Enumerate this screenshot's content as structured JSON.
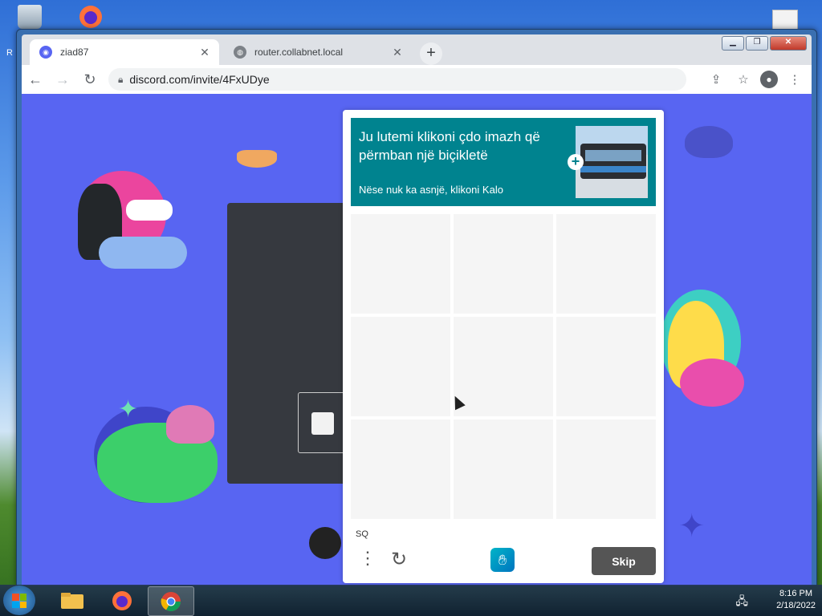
{
  "desktop": {
    "label_r": "R"
  },
  "browser": {
    "tabs": [
      {
        "title": "ziad87",
        "favicon": "discord-icon",
        "active": true
      },
      {
        "title": "router.collabnet.local",
        "favicon": "globe-icon",
        "active": false
      }
    ],
    "address": "discord.com/invite/4FxUDye"
  },
  "captcha": {
    "prompt_title": "Ju lutemi klikoni çdo imazh që përmban një biçikletë",
    "prompt_sub": "Nëse nuk ka asnjë, klikoni Kalo",
    "language": "SQ",
    "skip_label": "Skip",
    "accent": "#00838f"
  },
  "taskbar": {
    "time": "8:16 PM",
    "date": "2/18/2022"
  },
  "colors": {
    "discord_bg": "#5865f2",
    "dark_card": "#36393f"
  }
}
